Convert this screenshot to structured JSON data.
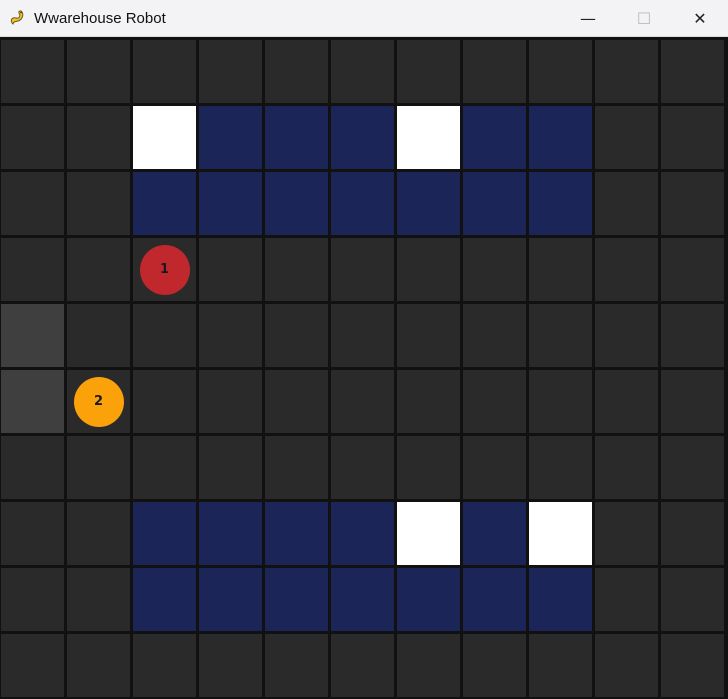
{
  "window": {
    "title": "Wwarehouse Robot",
    "app_icon": "pygame-snake-icon",
    "controls": {
      "minimize": "—",
      "maximize": "☐",
      "close": "✕"
    }
  },
  "grid": {
    "cols": 11,
    "rows": 10,
    "layout": [
      "...........",
      "..DSSSDSS..",
      "..SSSSSSS..",
      "...........",
      "C..........",
      "C..........",
      "...........",
      "..SSSSDSD..",
      "..SSSSSSS..",
      "..........."
    ],
    "legend": {
      ".": "floor",
      "S": "shelf",
      "D": "dock",
      "C": "charger"
    },
    "colors": {
      "floor": "#2a2a2a",
      "shelf": "#1b2558",
      "dock": "#ffffff",
      "charger": "#3f3f3f",
      "grid_line": "#111111"
    }
  },
  "robots": [
    {
      "id": "1",
      "label": "1",
      "row": 3,
      "col": 2,
      "color": "#c0282e"
    },
    {
      "id": "2",
      "label": "2",
      "row": 5,
      "col": 1,
      "color": "#fba10a"
    }
  ]
}
